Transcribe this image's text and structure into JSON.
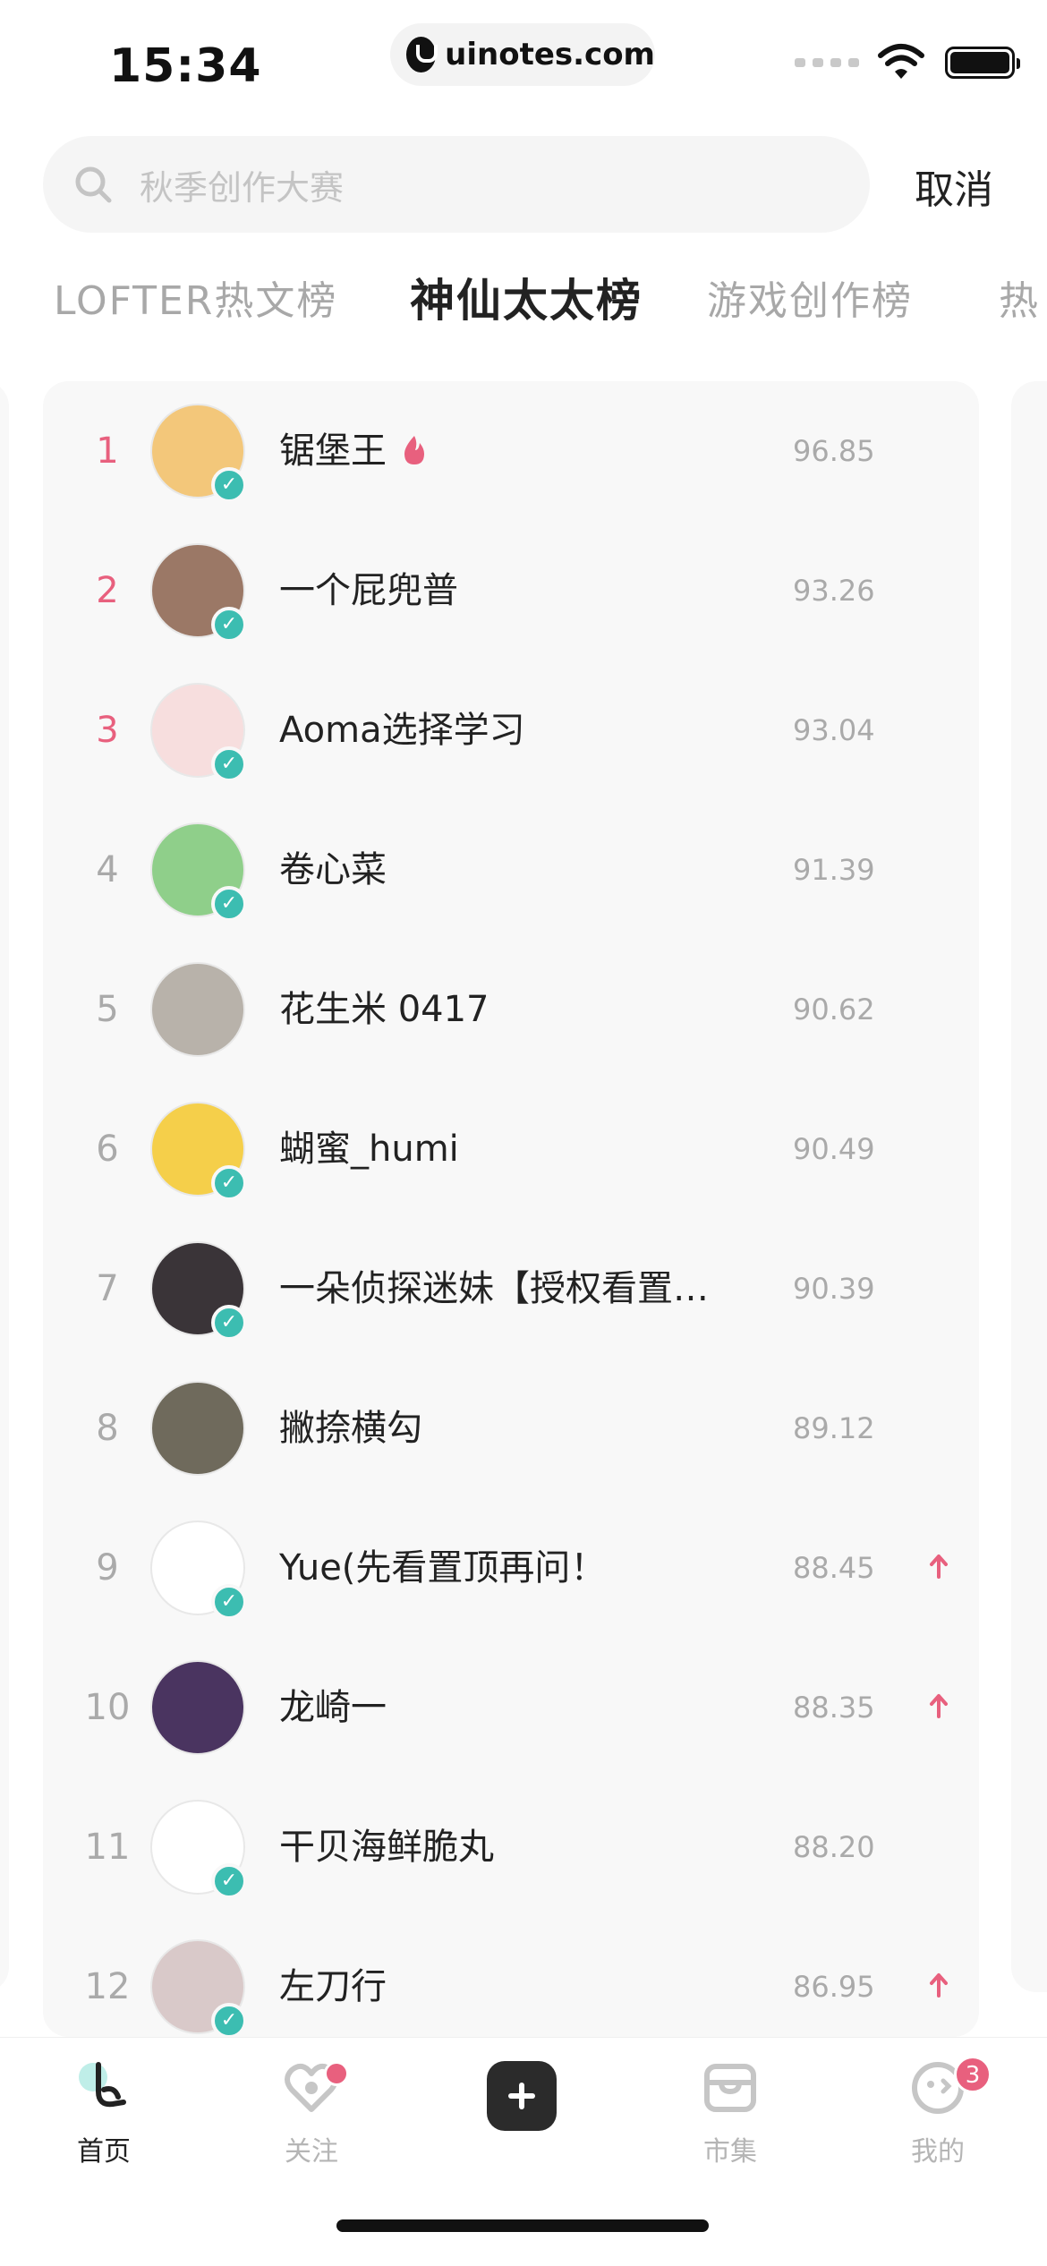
{
  "status_bar": {
    "time": "15:34",
    "url": "uinotes.com"
  },
  "search": {
    "placeholder": "秋季创作大赛",
    "cancel_label": "取消"
  },
  "tabs": [
    {
      "label": "LOFTER热文榜",
      "active": false
    },
    {
      "label": "神仙太太榜",
      "active": true
    },
    {
      "label": "游戏创作榜",
      "active": false
    },
    {
      "label": "热",
      "active": false
    }
  ],
  "ranking": [
    {
      "rank": "1",
      "name": "锯堡王",
      "score": "96.85",
      "verified": true,
      "hot": true,
      "trend": "",
      "avatar_color": "#f3c77a"
    },
    {
      "rank": "2",
      "name": "一个屁兜普",
      "score": "93.26",
      "verified": true,
      "hot": false,
      "trend": "",
      "avatar_color": "#9b7866"
    },
    {
      "rank": "3",
      "name": "Aoma选择学习",
      "score": "93.04",
      "verified": true,
      "hot": false,
      "trend": "",
      "avatar_color": "#f7dede"
    },
    {
      "rank": "4",
      "name": "卷心菜",
      "score": "91.39",
      "verified": true,
      "hot": false,
      "trend": "",
      "avatar_color": "#8fcf8a"
    },
    {
      "rank": "5",
      "name": "花生米 0417",
      "score": "90.62",
      "verified": false,
      "hot": false,
      "trend": "",
      "avatar_color": "#b8b2aa"
    },
    {
      "rank": "6",
      "name": "蝴蜜_humi",
      "score": "90.49",
      "verified": true,
      "hot": false,
      "trend": "",
      "avatar_color": "#f5cf4a"
    },
    {
      "rank": "7",
      "name": "一朵侦探迷妹【授权看置…",
      "score": "90.39",
      "verified": true,
      "hot": false,
      "trend": "",
      "avatar_color": "#3a3438"
    },
    {
      "rank": "8",
      "name": "撇捺横勾",
      "score": "89.12",
      "verified": false,
      "hot": false,
      "trend": "",
      "avatar_color": "#6f6a5c"
    },
    {
      "rank": "9",
      "name": "Yue(先看置顶再问！",
      "score": "88.45",
      "verified": true,
      "hot": false,
      "trend": "up",
      "avatar_color": "#ffffff"
    },
    {
      "rank": "10",
      "name": "龙崎一",
      "score": "88.35",
      "verified": false,
      "hot": false,
      "trend": "up",
      "avatar_color": "#4a3460"
    },
    {
      "rank": "11",
      "name": "干贝海鲜脆丸",
      "score": "88.20",
      "verified": true,
      "hot": false,
      "trend": "",
      "avatar_color": "#ffffff"
    },
    {
      "rank": "12",
      "name": "左刀行",
      "score": "86.95",
      "verified": true,
      "hot": false,
      "trend": "up",
      "avatar_color": "#d9c9c9"
    }
  ],
  "nav": {
    "home": "首页",
    "follow": "关注",
    "market": "市集",
    "me": "我的",
    "me_badge": "3"
  },
  "colors": {
    "accent_pink": "#e8607e",
    "verified_teal": "#3cbdb1"
  }
}
